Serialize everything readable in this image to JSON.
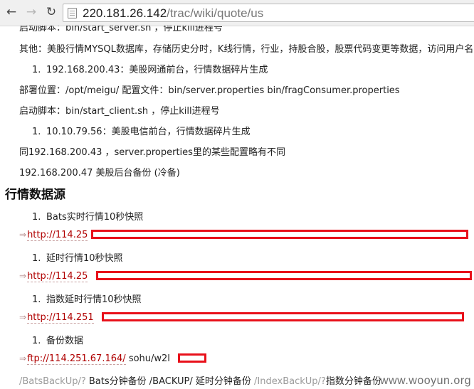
{
  "browser": {
    "url_host": "220.181.26.142",
    "url_path": "/trac/wiki/quote/us"
  },
  "content": {
    "partial_top": "启动脚本：bin/start_server.sh ，停止kill进程号",
    "other": "其他：美股行情MYSQL数据库，存储历史分时，K线行情，行业，持股合股，股票代码变更等数据，访问用户名",
    "item1": {
      "num": "1.",
      "text": "192.168.200.43：美股网通前台，行情数据碎片生成"
    },
    "deploy": "部署位置：/opt/meigu/ 配置文件：bin/server.properties bin/fragConsumer.properties",
    "start_client": "启动脚本：bin/start_client.sh ，停止kill进程号",
    "item2": {
      "num": "1.",
      "text": "10.10.79.56：美股电信前台，行情数据碎片生成"
    },
    "same_as": "同192.168.200.43 ，server.properties里的某些配置略有不同",
    "backup_host": "192.168.200.47 美股后台备份 (冷备)",
    "section_title": "行情数据源",
    "sources": [
      {
        "num": "1.",
        "label": "Bats实时行情10秒快照",
        "link": "http://114.25"
      },
      {
        "num": "1.",
        "label": "延时行情10秒快照",
        "link": "http://114.25"
      },
      {
        "num": "1.",
        "label": "指数延时行情10秒快照",
        "link": "http://114.251"
      },
      {
        "num": "1.",
        "label": "备份数据",
        "link": "ftp://114.251.67.164/",
        "suffix": "sohu/w2l"
      }
    ],
    "backup_links": {
      "bats_path": "/BatsBackUp/?",
      "bats_text": "Bats分钟备份",
      "backup_path": "/BACKUP/",
      "backup_text": "延时分钟备份",
      "index_path": "/IndexBackUp/?",
      "index_text": "指数分钟备份"
    },
    "watermark": "www.wooyun.org"
  },
  "colors": {
    "link": "#b00000",
    "redaction": "#e8101a"
  },
  "icons": [
    "back-arrow-icon",
    "forward-arrow-icon",
    "reload-icon",
    "page-icon",
    "external-link-icon"
  ]
}
